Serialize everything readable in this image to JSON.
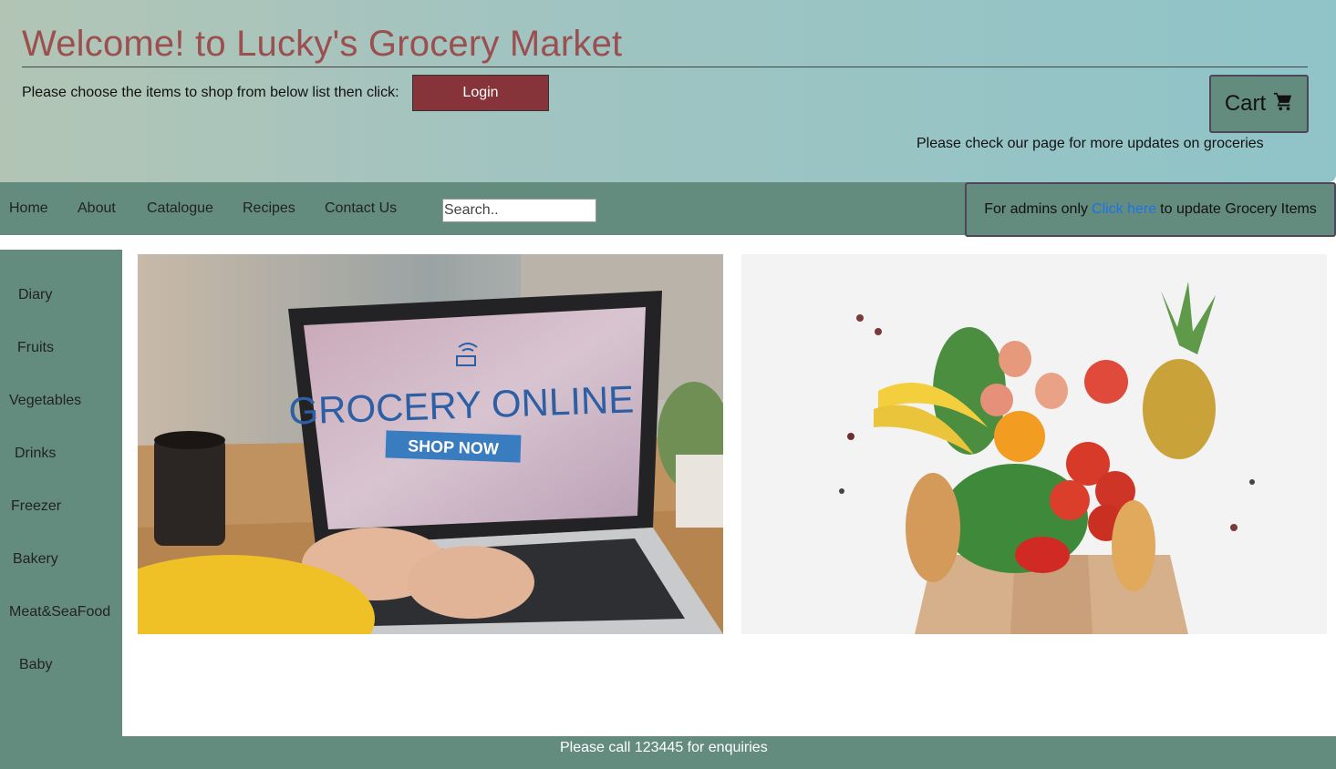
{
  "header": {
    "title": "Welcome! to Lucky's Grocery Market",
    "instruction": "Please choose the items to shop from below list then click:",
    "login_label": "Login",
    "cart_label": "Cart",
    "cart_icon": "shopping-cart-icon",
    "updates_text": "Please check our page for more updates on groceries"
  },
  "nav": {
    "links": [
      "Home",
      "About",
      "Catalogue",
      "Recipes",
      "Contact Us"
    ],
    "search_placeholder": "Search.."
  },
  "admin": {
    "prefix": "For admins only",
    "link_text": "Click here",
    "suffix": "to update Grocery Items"
  },
  "sidebar": {
    "items": [
      "Diary",
      "Fruits",
      "Vegetables",
      "Drinks",
      "Freezer",
      "Bakery",
      "Meat&SeaFood",
      "Baby"
    ]
  },
  "banner": {
    "laptop_screen_text": "GROCERY ONLINE",
    "laptop_button_text": "SHOP NOW"
  },
  "footer": {
    "text": "Please call 123445 for enquiries"
  },
  "colors": {
    "primary_green": "#648c7e",
    "title_red": "#9b4f4f",
    "login_bg": "#86333a",
    "link_blue": "#1a73e8"
  }
}
